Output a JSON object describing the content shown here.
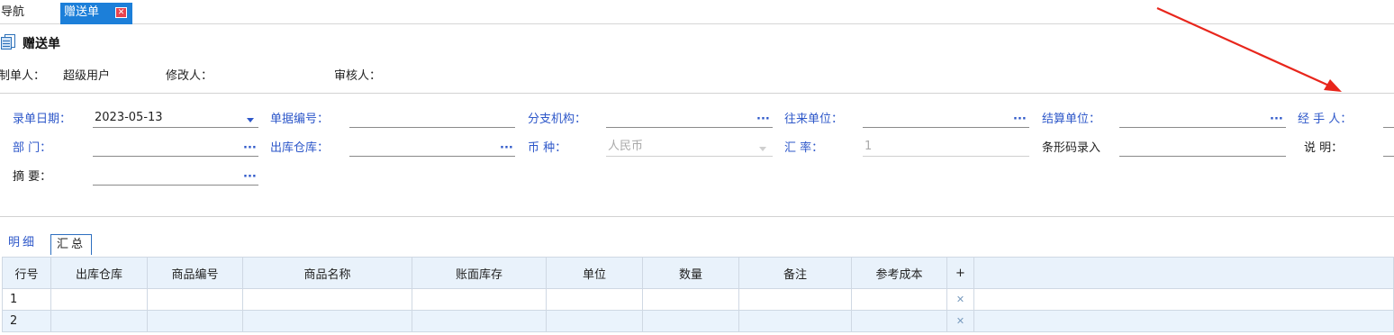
{
  "tabs": {
    "nav_label": "导航",
    "active_label": "赠送单",
    "close_glyph": "✕"
  },
  "title": "赠送单",
  "meta": {
    "maker_label": "制单人：",
    "maker_value": "超级用户",
    "modifier_label": "修改人：",
    "modifier_value": "",
    "auditor_label": "审核人：",
    "auditor_value": ""
  },
  "form": {
    "entry_date_label": "录单日期：",
    "entry_date_value": "2023-05-13",
    "doc_no_label": "单据编号：",
    "doc_no_value": "",
    "branch_label": "分支机构：",
    "branch_value": "",
    "partner_label": "往来单位：",
    "partner_value": "",
    "settle_label": "结算单位：",
    "settle_value": "",
    "handler_label": "经  手  人：",
    "handler_value": "",
    "dept_label": "部    门：",
    "dept_value": "",
    "warehouse_label": "出库仓库：",
    "warehouse_value": "",
    "currency_label": "币    种：",
    "currency_value": "人民币",
    "rate_label": "汇    率：",
    "rate_value": "1",
    "barcode_label": "条形码录入",
    "barcode_value": "",
    "note_label": "说    明：",
    "note_value": "",
    "summary_label": "摘    要：",
    "summary_value": "",
    "ellipsis": "···"
  },
  "detail_tabs": [
    "明细",
    "汇总"
  ],
  "grid": {
    "columns": [
      "行号",
      "出库仓库",
      "商品编号",
      "商品名称",
      "账面库存",
      "单位",
      "数量",
      "备注",
      "参考成本",
      "+"
    ],
    "rows": [
      {
        "no": "1",
        "delete_icon": "✕"
      },
      {
        "no": "2",
        "delete_icon": "✕"
      }
    ]
  },
  "colors": {
    "accent": "#1c7fd9",
    "label_blue": "#2d57c9",
    "grid_header": "#e9f2fb",
    "annotation": "#e8261c"
  },
  "icons": {
    "title_icon": "document-icon",
    "tab_close": "close-icon",
    "row_delete": "delete-row-icon",
    "lookup": "ellipsis-icon",
    "dropdown": "chevron-down-icon"
  }
}
